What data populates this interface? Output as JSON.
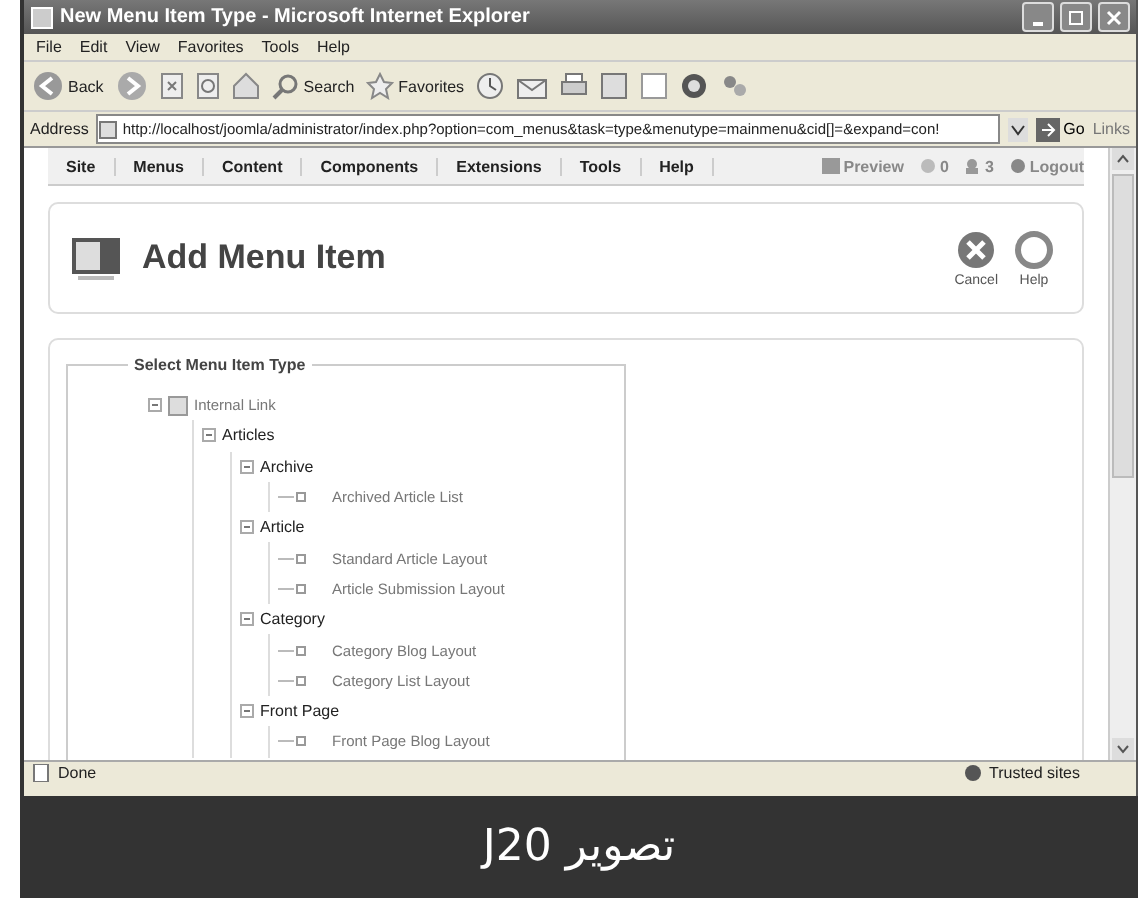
{
  "window": {
    "title": "New Menu Item Type - Microsoft Internet Explorer"
  },
  "menu_bar": [
    "File",
    "Edit",
    "View",
    "Favorites",
    "Tools",
    "Help"
  ],
  "toolbar": {
    "back": "Back",
    "search": "Search",
    "favorites": "Favorites"
  },
  "address_bar": {
    "label": "Address",
    "url": "http://localhost/joomla/administrator/index.php?option=com_menus&task=type&menutype=mainmenu&cid[]=&expand=con!",
    "go": "Go",
    "links": "Links"
  },
  "admin_menu": [
    "Site",
    "Menus",
    "Content",
    "Components",
    "Extensions",
    "Tools",
    "Help"
  ],
  "admin_status": {
    "preview": "Preview",
    "messages": "0",
    "users": "3",
    "logout": "Logout"
  },
  "header": {
    "title": "Add Menu Item",
    "buttons": [
      {
        "kind": "cancel",
        "label": "Cancel"
      },
      {
        "kind": "help",
        "label": "Help"
      }
    ]
  },
  "fieldset": {
    "legend": "Select Menu Item Type",
    "tree": [
      {
        "label": "Internal Link",
        "expanded": true,
        "children": [
          {
            "label": "Articles",
            "expanded": true,
            "children": [
              {
                "label": "Archive",
                "expanded": true,
                "children": [
                  {
                    "label": "Archived Article List"
                  }
                ]
              },
              {
                "label": "Article",
                "expanded": true,
                "children": [
                  {
                    "label": "Standard Article Layout"
                  },
                  {
                    "label": "Article Submission Layout"
                  }
                ]
              },
              {
                "label": "Category",
                "expanded": true,
                "children": [
                  {
                    "label": "Category Blog Layout"
                  },
                  {
                    "label": "Category List Layout"
                  }
                ]
              },
              {
                "label": "Front Page",
                "expanded": true,
                "children": [
                  {
                    "label": "Front Page Blog Layout"
                  }
                ]
              }
            ]
          }
        ]
      }
    ]
  },
  "status_bar": {
    "text": "Done",
    "zone": "Trusted sites"
  },
  "caption": "تصویر J20"
}
